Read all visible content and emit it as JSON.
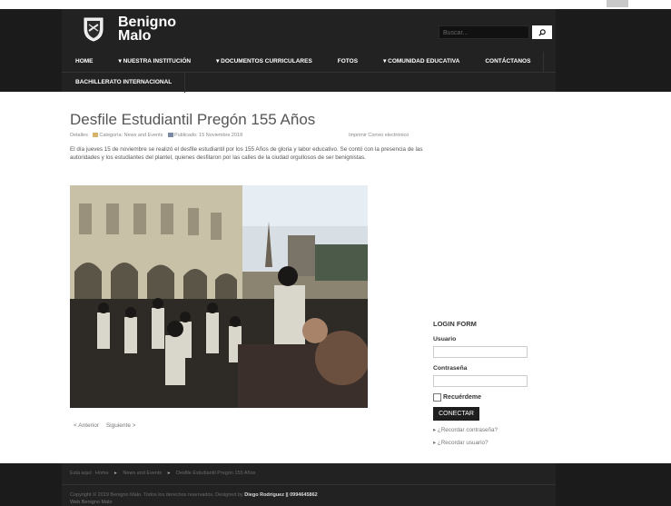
{
  "header": {
    "logo_line1": "Benigno",
    "logo_line2": "Malo",
    "search_placeholder": "Buscar..."
  },
  "nav": {
    "row1": [
      "HOME",
      "▾ NUESTRA INSTITUCIÓN",
      "▾ DOCUMENTOS CURRICULARES",
      "FOTOS",
      "▾ COMUNIDAD EDUCATIVA",
      "CONTÁCTANOS"
    ],
    "row2": [
      "BACHILLERATO INTERNACIONAL"
    ]
  },
  "article": {
    "title": "Desfile Estudiantil Pregón 155 Años",
    "details_label": "Detalles",
    "category": "Categoría: News and Events",
    "published": "Publicado: 15 Noviembre 2018",
    "actions": "Imprimir Correo electrónico",
    "body": "El día jueves 15 de noviembre se realizó el desfile estudiantil por los 155 Años de gloria y labor educativo. Se contó con la presencia de las autoridades y los estudiantes del plantel, quienes desfilaron por las calles de la ciudad orgullosos de ser benignistas.",
    "prev": "< Anterior",
    "next": "Siguiente >"
  },
  "login": {
    "title": "LOGIN FORM",
    "user_label": "Usuario",
    "pass_label": "Contraseña",
    "remember": "Recuérdeme",
    "submit": "CONECTAR",
    "forgot_pass": "▸ ¿Recordar contraseña?",
    "forgot_user": "▸ ¿Recordar usuario?"
  },
  "footer": {
    "here": "Está aquí:",
    "crumbs": [
      "Home",
      "News and Events",
      "Desfile Estudiantil Pregón 155 Años"
    ],
    "copyright": "Copyright © 2019 Benigno Malo. Todos los derechos reservados. Designed by",
    "designer": "Diego Rodríguez || 0994645862",
    "webname": "Web Benigno Malo"
  }
}
